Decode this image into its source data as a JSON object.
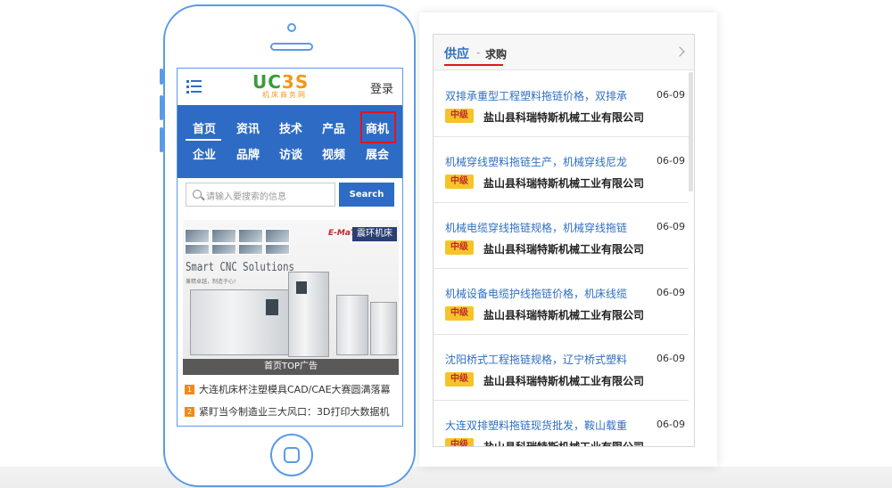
{
  "phone": {
    "header": {
      "login_label": "登录"
    },
    "logo": {
      "main_left": "UC",
      "main_mid": "3",
      "main_right": "S",
      "sub": "机床商务网"
    },
    "nav": [
      {
        "label": "首页"
      },
      {
        "label": "资讯"
      },
      {
        "label": "技术"
      },
      {
        "label": "产品"
      },
      {
        "label": "商机"
      },
      {
        "label": "企业"
      },
      {
        "label": "品牌"
      },
      {
        "label": "访谈"
      },
      {
        "label": "视频"
      },
      {
        "label": "展会"
      }
    ],
    "search": {
      "placeholder": "请输入要搜索的信息",
      "button_label": "Search"
    },
    "banner": {
      "brand_logo": "E-MaT",
      "brand_cn": "震环机床",
      "title": "Smart CNC Solutions",
      "subtitle": "兼精卓越，制造于心!",
      "caption": "首页TOP广告"
    },
    "news": [
      {
        "num": "1",
        "text": "大连机床杯注塑模具CAD/CAE大赛圆满落幕"
      },
      {
        "num": "2",
        "text": "紧盯当今制造业三大风口：3D打印大数据机"
      }
    ]
  },
  "panel": {
    "tab_supply": "供应",
    "tab_sep": "-",
    "tab_buy": "求购",
    "items": [
      {
        "title": "双排承重型工程塑料拖链价格，双排承",
        "date": "06-09",
        "badge": "中级",
        "company": "盐山县科瑞特斯机械工业有限公司"
      },
      {
        "title": "机械穿线塑料拖链生产，机械穿线尼龙",
        "date": "06-09",
        "badge": "中级",
        "company": "盐山县科瑞特斯机械工业有限公司"
      },
      {
        "title": "机械电缆穿线拖链规格，机械穿线拖链",
        "date": "06-09",
        "badge": "中级",
        "company": "盐山县科瑞特斯机械工业有限公司"
      },
      {
        "title": "机械设备电缆护线拖链价格，机床线缆",
        "date": "06-09",
        "badge": "中级",
        "company": "盐山县科瑞特斯机械工业有限公司"
      },
      {
        "title": "沈阳桥式工程拖链规格，辽宁桥式塑料",
        "date": "06-09",
        "badge": "中级",
        "company": "盐山县科瑞特斯机械工业有限公司"
      },
      {
        "title": "大连双排塑料拖链现货批发，鞍山载重",
        "date": "06-09",
        "badge": "中级",
        "company": "盐山县科瑞特斯机械工业有限公司"
      }
    ]
  }
}
